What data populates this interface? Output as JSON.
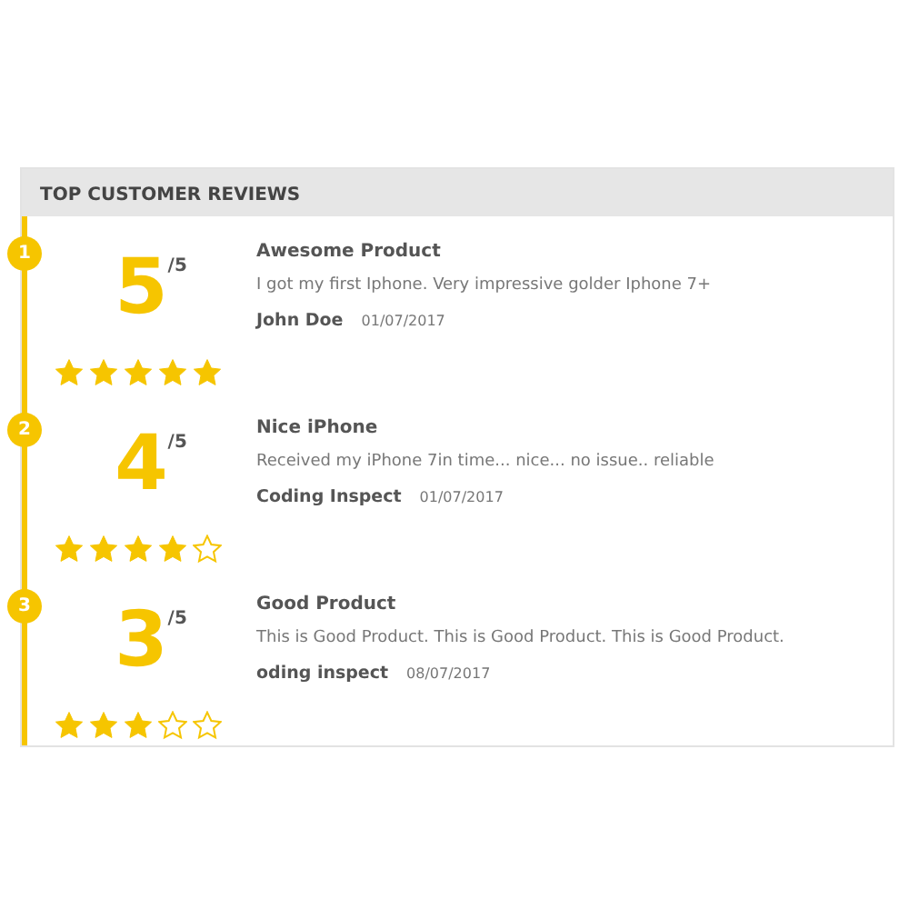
{
  "panel": {
    "title": "TOP CUSTOMER REVIEWS"
  },
  "reviews": [
    {
      "rank": "1",
      "score": "5",
      "out_of": "/5",
      "stars": 5,
      "title": "Awesome Product",
      "text": "I got my first Iphone. Very impressive golder Iphone 7+",
      "author": "John Doe",
      "date": "01/07/2017"
    },
    {
      "rank": "2",
      "score": "4",
      "out_of": "/5",
      "stars": 4,
      "title": "Nice iPhone",
      "text": "Received my iPhone 7in time... nice... no issue.. reliable",
      "author": "Coding Inspect",
      "date": "01/07/2017"
    },
    {
      "rank": "3",
      "score": "3",
      "out_of": "/5",
      "stars": 3,
      "title": "Good Product",
      "text": "This is Good Product. This is Good Product. This is Good Product.",
      "author": "oding inspect",
      "date": "08/07/2017"
    }
  ]
}
